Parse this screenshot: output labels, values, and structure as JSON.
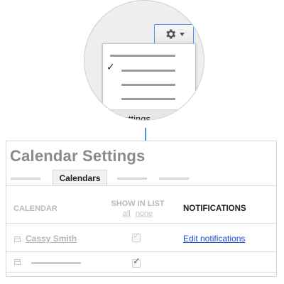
{
  "dropdown": {
    "gear_button_label": "",
    "settings_label": "Settings",
    "checked_item_index": 1
  },
  "panel": {
    "title": "Calendar Settings",
    "active_tab": "Calendars",
    "columns": {
      "calendar": "CALENDAR",
      "show_in_list": "SHOW IN LIST",
      "show_all": "all",
      "show_none": "none",
      "notifications": "NOTIFICATIONS"
    },
    "rows": [
      {
        "name": "Cassy Smith",
        "show_in_list": true,
        "notifications_link": "Edit notifications"
      },
      {
        "name": "",
        "show_in_list": true,
        "notifications_link": ""
      }
    ]
  },
  "colors": {
    "accent_blue": "#4d90fe",
    "link_blue": "#1a4fd6",
    "title_grey": "#8a8a8a"
  },
  "icons": [
    "gear-icon",
    "caret-down-icon",
    "checkmark-icon",
    "arrow-down-icon",
    "calendar-icon"
  ]
}
